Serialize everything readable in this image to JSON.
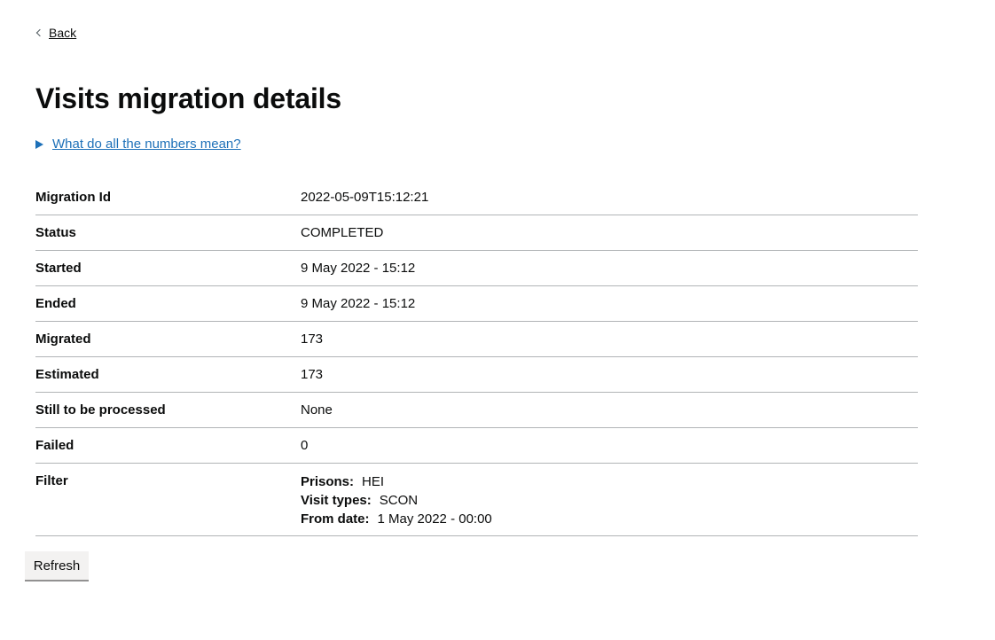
{
  "back": {
    "label": "Back"
  },
  "page": {
    "title": "Visits migration details"
  },
  "details": {
    "summary": "What do all the numbers mean?"
  },
  "summary_list": [
    {
      "key": "Migration Id",
      "value": "2022-05-09T15:12:21"
    },
    {
      "key": "Status",
      "value": "COMPLETED"
    },
    {
      "key": "Started",
      "value": "9 May 2022 - 15:12"
    },
    {
      "key": "Ended",
      "value": "9 May 2022 - 15:12"
    },
    {
      "key": "Migrated",
      "value": "173"
    },
    {
      "key": "Estimated",
      "value": "173"
    },
    {
      "key": "Still to be processed",
      "value": "None"
    },
    {
      "key": "Failed",
      "value": "0"
    }
  ],
  "filter": {
    "key": "Filter",
    "items": [
      {
        "label": "Prisons:",
        "value": "HEI"
      },
      {
        "label": "Visit types:",
        "value": "SCON"
      },
      {
        "label": "From date:",
        "value": "1 May 2022 - 00:00"
      }
    ]
  },
  "actions": {
    "refresh_label": "Refresh"
  },
  "colors": {
    "link": "#1d70b8",
    "text": "#0b0c0c",
    "border": "#b1b4b6",
    "button_bg": "#f3f2f1"
  }
}
